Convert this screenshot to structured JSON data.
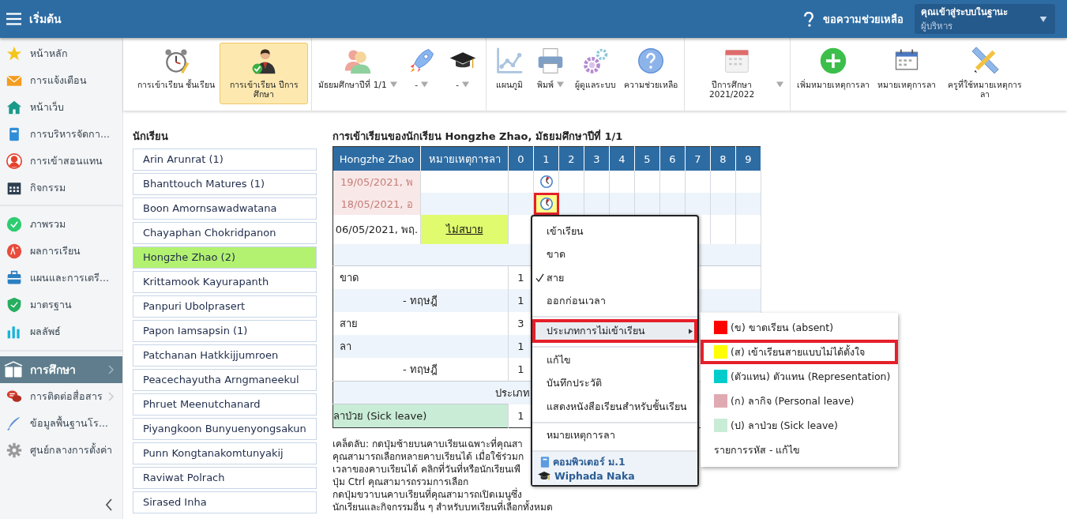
{
  "header": {
    "title": "เริ่มต้น",
    "help": "ขอความช่วยเหลือ",
    "user_caption": "คุณเข้าสู่ระบบในฐานะ",
    "user_role": "ผู้บริหาร"
  },
  "sidebar": {
    "groups": [
      {
        "items": [
          {
            "kind": "star",
            "label": "หน้าหลัก",
            "selected": false,
            "arrow": false
          },
          {
            "kind": "envelope",
            "label": "การแจ้งเตือน",
            "selected": false,
            "arrow": false
          },
          {
            "kind": "house",
            "label": "หน้าเว็บ",
            "selected": false,
            "arrow": false
          },
          {
            "kind": "notebook",
            "label": "การบริหารจัดกา...",
            "selected": false,
            "arrow": false
          },
          {
            "kind": "person",
            "label": "การเข้าสอนแทน",
            "selected": false,
            "arrow": false
          },
          {
            "kind": "calendar",
            "label": "กิจกรรม",
            "selected": false,
            "arrow": false
          }
        ]
      },
      {
        "items": [
          {
            "kind": "check",
            "label": "ภาพรวม",
            "selected": false,
            "arrow": false
          },
          {
            "kind": "grade",
            "label": "ผลการเรียน",
            "selected": false,
            "arrow": false
          },
          {
            "kind": "briefcase",
            "label": "แผนและการเตรี...",
            "selected": false,
            "arrow": false
          },
          {
            "kind": "shield",
            "label": "มาตรฐาน",
            "selected": false,
            "arrow": false
          },
          {
            "kind": "bars",
            "label": "ผลลัพธ์",
            "selected": false,
            "arrow": false
          }
        ]
      },
      {
        "items": [
          {
            "kind": "book",
            "label": "การศึกษา",
            "selected": true,
            "arrow": true
          },
          {
            "kind": "chat",
            "label": "การติดต่อสื่อสาร",
            "selected": false,
            "arrow": true
          },
          {
            "kind": "pen",
            "label": "ข้อมูลพื้นฐานโร...",
            "selected": false,
            "arrow": false
          },
          {
            "kind": "gear",
            "label": "ศูนย์กลางการตั้งค่า",
            "selected": false,
            "arrow": false
          }
        ]
      }
    ]
  },
  "toolbar": {
    "groups": [
      {
        "items": [
          {
            "kind": "alarm-clock",
            "label": "การเข้าเรียน ชั้นเรียน",
            "selected": false,
            "dropdown": false
          },
          {
            "kind": "person-check",
            "label": "การเข้าเรียน ปีการศึกษา",
            "selected": true,
            "dropdown": false
          }
        ]
      },
      {
        "items": [
          {
            "kind": "people",
            "label": "มัธยมศึกษาปีที่ 1/1",
            "selected": false,
            "dropdown": true
          },
          {
            "kind": "rocket",
            "label": "-",
            "selected": false,
            "dropdown": true
          },
          {
            "kind": "grad-cap",
            "label": "-",
            "selected": false,
            "dropdown": true
          }
        ]
      },
      {
        "items": [
          {
            "kind": "line-chart",
            "label": "แผนภูมิ",
            "selected": false,
            "dropdown": false
          },
          {
            "kind": "printer",
            "label": "พิมพ์",
            "selected": false,
            "dropdown": true
          },
          {
            "kind": "gears",
            "label": "ผู้ดูแลระบบ",
            "selected": false,
            "dropdown": false
          },
          {
            "kind": "question",
            "label": "ความช่วยเหลือ",
            "selected": false,
            "dropdown": false
          }
        ]
      },
      {
        "items": [
          {
            "kind": "calendar-page",
            "label": "ปีการศึกษา 2021/2022",
            "selected": false,
            "dropdown": true
          }
        ]
      },
      {
        "items": [
          {
            "kind": "plus",
            "label": "เพิ่มหมายเหตุการลา",
            "selected": false,
            "dropdown": false
          },
          {
            "kind": "desk-calendar",
            "label": "หมายเหตุการลา",
            "selected": false,
            "dropdown": false
          },
          {
            "kind": "ruler-pencil",
            "label": "ครูที่ใช้หมายเหตุการลา",
            "selected": false,
            "dropdown": false
          }
        ]
      }
    ]
  },
  "students": {
    "heading": "นักเรียน",
    "items": [
      {
        "name": "Arin Arunrat (1)",
        "selected": false
      },
      {
        "name": "Bhanttouch Matures (1)",
        "selected": false
      },
      {
        "name": "Boon Amornsawadwatana",
        "selected": false
      },
      {
        "name": "Chayaphan Chokridpanon",
        "selected": false
      },
      {
        "name": "Hongzhe Zhao (2)",
        "selected": true
      },
      {
        "name": "Krittamook Kayurapanth",
        "selected": false
      },
      {
        "name": "Panpuri Ubolprasert",
        "selected": false
      },
      {
        "name": "Papon Iamsapsin (1)",
        "selected": false
      },
      {
        "name": "Patchanan Hatkkijjumroen",
        "selected": false
      },
      {
        "name": "Peacechayutha Arngmaneekul",
        "selected": false
      },
      {
        "name": "Phruet Meenutchanard",
        "selected": false
      },
      {
        "name": "Piyangkoon Bunyuenyongsakun",
        "selected": false
      },
      {
        "name": "Punn Kongtanakomtunyakij",
        "selected": false
      },
      {
        "name": "Raviwat Polrach",
        "selected": false
      },
      {
        "name": "Sirased Inha",
        "selected": false
      }
    ]
  },
  "attendance": {
    "title": "การเข้าเรียนของนักเรียน Hongzhe Zhao, มัธยมศึกษาปีที่ 1/1",
    "columns": [
      "Hongzhe Zhao",
      "หมายเหตุการลา",
      "0",
      "1",
      "2",
      "3",
      "4",
      "5",
      "6",
      "7",
      "8",
      "9"
    ],
    "rows": [
      {
        "date": "19/05/2021, พ",
        "flagged": true,
        "cells": [
          {
            "late": false,
            "selected": false,
            "highlighted": false
          },
          {
            "late": true,
            "selected": false,
            "highlighted": false
          },
          {
            "late": false,
            "selected": false,
            "highlighted": false
          },
          {
            "late": false,
            "selected": false,
            "highlighted": false
          },
          {
            "late": false,
            "selected": false,
            "highlighted": false
          },
          {
            "late": false,
            "selected": false,
            "highlighted": false
          },
          {
            "late": false,
            "selected": false,
            "highlighted": false
          },
          {
            "late": false,
            "selected": false,
            "highlighted": false
          },
          {
            "late": false,
            "selected": false,
            "highlighted": false
          },
          {
            "late": false,
            "selected": false,
            "highlighted": false
          }
        ]
      },
      {
        "date": "18/05/2021, อ",
        "flagged": true,
        "cells": [
          {
            "late": false,
            "selected": false,
            "highlighted": false
          },
          {
            "late": true,
            "selected": true,
            "highlighted": true
          },
          {
            "late": false,
            "selected": false,
            "highlighted": false
          },
          {
            "late": false,
            "selected": false,
            "highlighted": false
          },
          {
            "late": false,
            "selected": false,
            "highlighted": false
          },
          {
            "late": false,
            "selected": false,
            "highlighted": false
          },
          {
            "late": false,
            "selected": false,
            "highlighted": false
          },
          {
            "late": false,
            "selected": false,
            "highlighted": false
          },
          {
            "late": false,
            "selected": false,
            "highlighted": false
          },
          {
            "late": false,
            "selected": false,
            "highlighted": false
          }
        ]
      },
      {
        "date": "06/05/2021, พฤ.",
        "flagged": false,
        "note": "ไม่สบาย",
        "cells": [
          {
            "late": false,
            "selected": false,
            "highlighted": false
          }
        ]
      }
    ],
    "summary": [
      {
        "label": "ขาด",
        "count": "1",
        "children": [
          {
            "label": "- ทฤษฎี",
            "count": "1"
          }
        ]
      },
      {
        "label": "สาย",
        "count": "3"
      },
      {
        "label": "ลา",
        "count": "1",
        "children": [
          {
            "label": "- ทฤษฎี",
            "count": "1"
          }
        ]
      }
    ],
    "types_heading": "ประเภท",
    "types": [
      {
        "label": "ลาป่วย (Sick leave)",
        "count": "1",
        "color": "#c9ecd6"
      }
    ]
  },
  "tip": {
    "lines": [
      "เคล็ดลับ: กดปุ่มซ้ายบนคาบเรียนเฉพาะที่คุณสา",
      "คุณสามารถเลือกหลายคาบเรียนได้ เมื่อใช้ร่วมก",
      "เวลาของคาบเรียนได้ คลิกที่วันที่หรือนักเรียนเพื",
      "ปุ่ม Ctrl คุณสามารถรวมการเลือก",
      "กดปุ่มขวาบนคาบเรียนที่คุณสามารถเปิดเมนูซึ่ง",
      "นักเรียนและกิจกรรมอื่น ๆ สำหรับบทเรียนที่เลือกทั้งหมด"
    ]
  },
  "context_menu": {
    "items": [
      {
        "kind": "item",
        "label": "เข้าเรียน",
        "checked": false
      },
      {
        "kind": "item",
        "label": "ขาด",
        "checked": false
      },
      {
        "kind": "item",
        "label": "สาย",
        "checked": true
      },
      {
        "kind": "item",
        "label": "ออกก่อนเวลา",
        "checked": false
      },
      {
        "kind": "divider"
      },
      {
        "kind": "submenu",
        "label": "ประเภทการไม่เข้าเรียน",
        "highlighted": true
      },
      {
        "kind": "divider"
      },
      {
        "kind": "item",
        "label": "แก้ไข",
        "checked": false
      },
      {
        "kind": "item",
        "label": "บันทึกประวัติ",
        "checked": false
      },
      {
        "kind": "item",
        "label": "แสดงหนังสือเรียนสำหรับชั้นเรียน",
        "checked": false
      },
      {
        "kind": "divider"
      },
      {
        "kind": "item",
        "label": "หมายเหตุการลา",
        "checked": false
      }
    ],
    "subject": "คอมพิวเตอร์ ม.1",
    "teacher": "Wiphada Naka"
  },
  "submenu": {
    "items": [
      {
        "kind": "type",
        "label": "(ข) ขาดเรียน (absent)",
        "color": "#ff0000",
        "highlighted": false
      },
      {
        "kind": "type",
        "label": "(ส) เข้าเรียนสายแบบไม่ได้ตั้งใจ",
        "color": "#ffff00",
        "highlighted": true
      },
      {
        "kind": "type",
        "label": "(ตัวแทน) ตัวแทน (Representation)",
        "color": "#00cccc",
        "highlighted": false
      },
      {
        "kind": "type",
        "label": "(ก) ลากิจ (Personal leave)",
        "color": "#e0aab2",
        "highlighted": false
      },
      {
        "kind": "type",
        "label": "(ป) ลาป่วย (Sick leave)",
        "color": "#c9ecd6",
        "highlighted": false
      },
      {
        "kind": "link",
        "label": "รายการรหัส - แก้ไข"
      }
    ]
  }
}
